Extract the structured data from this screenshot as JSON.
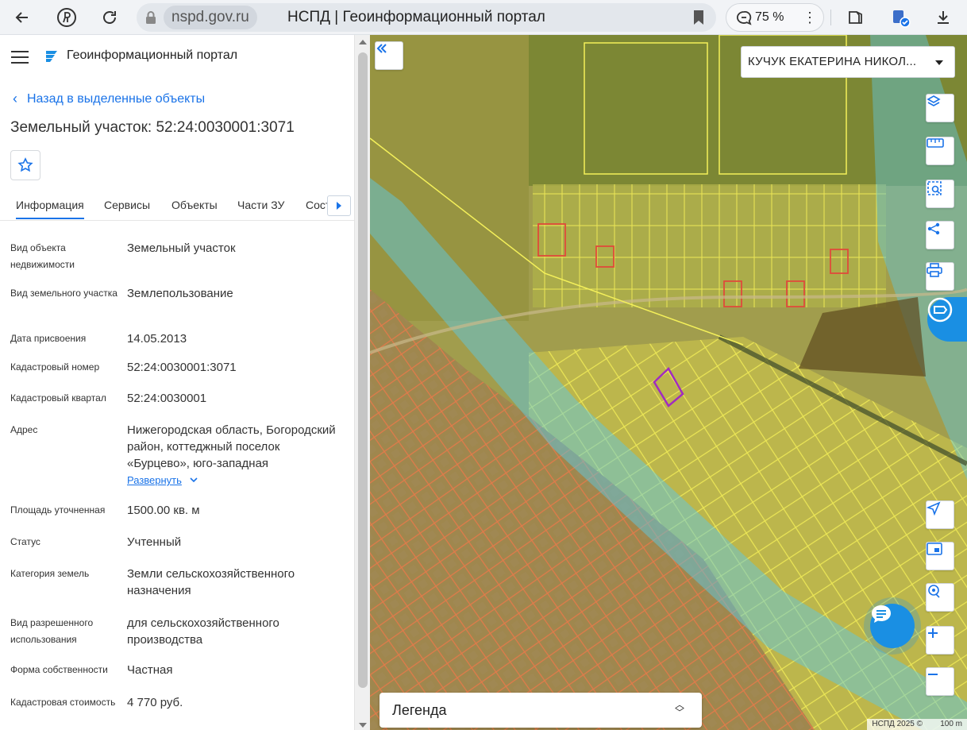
{
  "browser": {
    "domain": "nspd.gov.ru",
    "tab_title": "НСПД | Геоинформационный портал",
    "zoom": "75 %",
    "menu": "⋮"
  },
  "panel": {
    "portal_name": "Геоинформационный портал",
    "back_label": "Назад в выделенные объекты",
    "object_title": "Земельный участок: 52:24:0030001:3071",
    "tabs": [
      {
        "label": "Информация",
        "active": true
      },
      {
        "label": "Сервисы"
      },
      {
        "label": "Объекты"
      },
      {
        "label": "Части ЗУ"
      },
      {
        "label": "Сост"
      }
    ],
    "fields": [
      {
        "label": "Вид объекта недвижимости",
        "value": "Земельный участок"
      },
      {
        "label": "Вид земельного участка",
        "value": "Землепользование"
      },
      {
        "label": "Дата присвоения",
        "value": "14.05.2013"
      },
      {
        "label": "Кадастровый номер",
        "value": "52:24:0030001:3071"
      },
      {
        "label": "Кадастровый квартал",
        "value": "52:24:0030001"
      },
      {
        "label": "Адрес",
        "value": "Нижегородская область, Богородский район, коттеджный поселок «Бурцево», юго-западная",
        "expand": "Развернуть"
      },
      {
        "label": "Площадь уточненная",
        "value": "1500.00 кв. м"
      },
      {
        "label": "Статус",
        "value": "Учтенный"
      },
      {
        "label": "Категория земель",
        "value": "Земли сельскохозяйственного назначения"
      },
      {
        "label": "Вид разрешенного использования",
        "value": "для сельскохозяйственного производства"
      },
      {
        "label": "Форма собственности",
        "value": "Частная"
      },
      {
        "label": "Кадастровая стоимость",
        "value": "4 770 руб."
      }
    ]
  },
  "map": {
    "user_name": "КУЧУК ЕКАТЕРИНА НИКОЛ...",
    "legend_label": "Легенда",
    "attribution": "НСПД 2025 ©",
    "scale_label": "100 m"
  },
  "colors": {
    "accent": "#1a73e8",
    "chat_blue": "#1a8fe3",
    "parcel_yellow": "#e6e24a",
    "parcel_red": "#e04a3a",
    "zone_blue": "#5fc8e0",
    "selected_parcel": "#9b2bb8"
  },
  "icons": {
    "back": "arrow-left-icon",
    "yandex": "yandex-logo-icon",
    "reload": "reload-icon",
    "lock": "lock-icon",
    "bookmark": "bookmark-icon",
    "chat_zoom": "chat-bubble-icon",
    "extensions": "extensions-icon",
    "download": "download-icon"
  }
}
